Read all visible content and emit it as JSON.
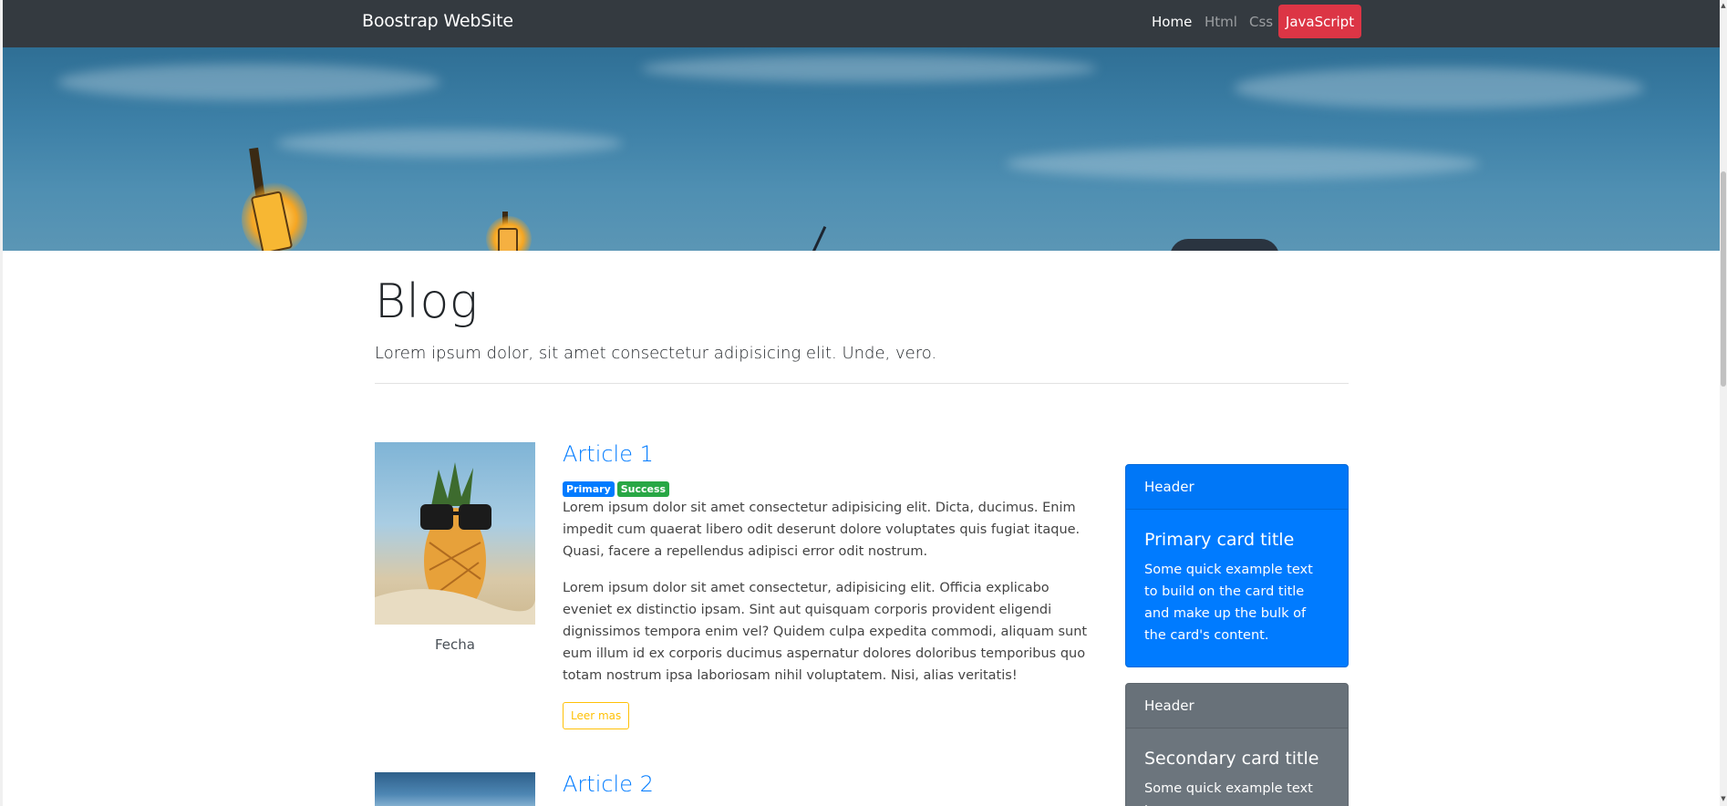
{
  "navbar": {
    "brand": "Boostrap WebSite",
    "links": [
      "Home",
      "Html",
      "Css"
    ],
    "button_label": "JavaScript"
  },
  "hero": {
    "image": "beach-lamps-sky"
  },
  "blog": {
    "title": "Blog",
    "lead": "Lorem ipsum dolor, sit amet consectetur adipisicing elit. Unde, vero."
  },
  "articles": [
    {
      "title": "Article 1",
      "badges": [
        "Primary",
        "Success"
      ],
      "image": "pineapple-sunglasses-photo",
      "caption": "Fecha",
      "paragraphs": [
        "Lorem ipsum dolor sit amet consectetur adipisicing elit. Dicta, ducimus. Enim impedit cum quaerat libero odit deserunt dolore voluptates quis fugiat itaque. Quasi, facere a repellendus adipisci error odit nostrum.",
        "Lorem ipsum dolor sit amet consectetur, adipisicing elit. Officia explicabo eveniet ex distinctio ipsam. Sint aut quisquam corporis provident eligendi dignissimos tempora enim vel? Quidem culpa expedita commodi, aliquam sunt eum illum id ex corporis ducimus aspernatur dolores doloribus temporibus quo totam nostrum ipsa laboriosam nihil voluptatem. Nisi, alias veritatis!"
      ],
      "button_label": "Leer mas"
    },
    {
      "title": "Article 2",
      "image": "sky-photo"
    }
  ],
  "sidebar": {
    "cards": [
      {
        "header": "Header",
        "title": "Primary card title",
        "text": "Some quick example text to build on the card title and make up the bulk of the card's content.",
        "color": "#007bff"
      },
      {
        "header": "Header",
        "title": "Secondary card title",
        "text": "Some quick example text to",
        "color": "#6c757d"
      }
    ]
  },
  "colors": {
    "navbar": "#343a40",
    "danger": "#dc3545",
    "primary": "#007bff",
    "success": "#28a745",
    "warning": "#ffc107",
    "secondary": "#6c757d"
  }
}
